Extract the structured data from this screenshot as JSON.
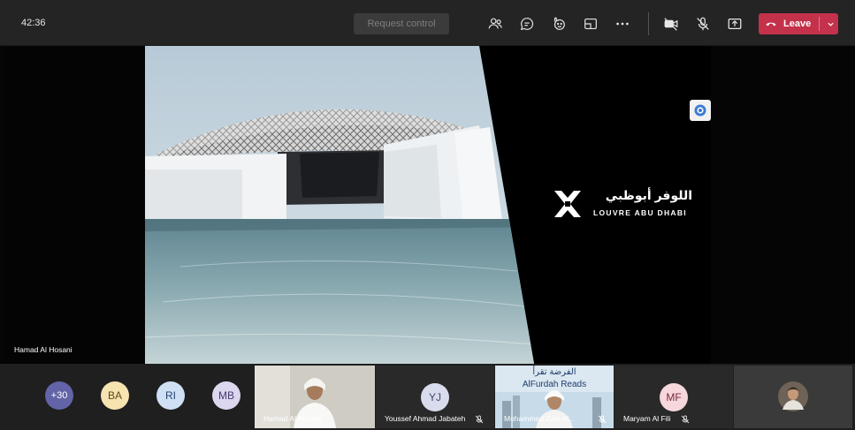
{
  "toolbar": {
    "timer": "42:36",
    "request_control_label": "Request control",
    "leave_label": "Leave",
    "icons": [
      "people-icon",
      "chat-icon",
      "reactions-icon",
      "share-tray-icon",
      "more-icon",
      "camera-off-icon",
      "mic-off-icon",
      "share-icon"
    ]
  },
  "stage": {
    "presenter_name": "Hamad Al Hosani",
    "slide": {
      "logo_arabic": "اللوفر أبوظبي",
      "logo_english": "LOUVRE ABU DHABI"
    }
  },
  "participants": {
    "overflow_count": "+30",
    "avatars": [
      {
        "initials": "BA",
        "bg": "#f6e3b0",
        "fg": "#5a4a1a"
      },
      {
        "initials": "RI",
        "bg": "#cfe0f4",
        "fg": "#24466f"
      },
      {
        "initials": "MB",
        "bg": "#dcd6ef",
        "fg": "#443b6b"
      }
    ],
    "tiles": [
      {
        "name": "Hamad Al Hosani",
        "type": "video"
      },
      {
        "name": "Youssef Ahmad Jabateh",
        "initials": "YJ",
        "muted": true,
        "bg": "#d9dcec",
        "fg": "#444a6a"
      },
      {
        "name": "Mohammed Zain Al...",
        "type": "video",
        "banner_arabic": "الفرضة تقرأ",
        "banner_english": "AlFurdah Reads",
        "muted": true
      },
      {
        "name": "Maryam Al Fili",
        "initials": "MF",
        "muted": true,
        "bg": "#f6d7dc",
        "fg": "#7a2a3a"
      }
    ]
  },
  "colors": {
    "leave": "#c4314b",
    "overflow_bg": "#6264a7"
  }
}
